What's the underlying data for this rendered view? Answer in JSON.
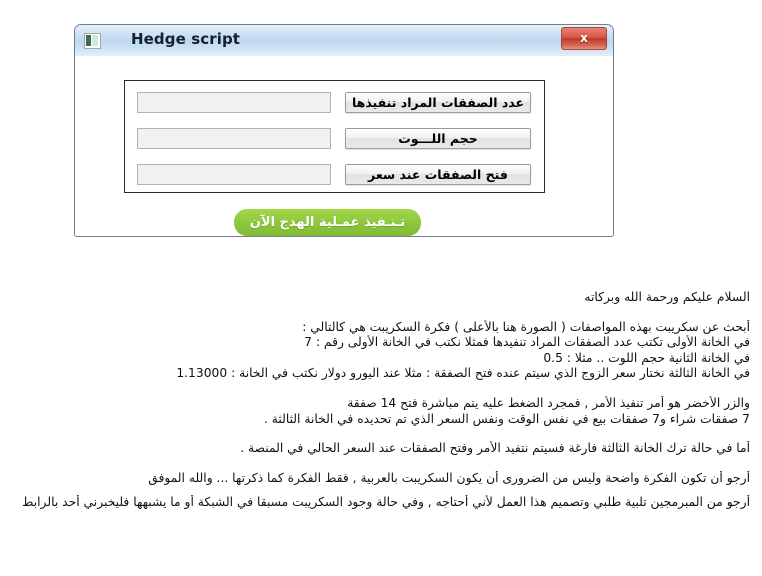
{
  "window": {
    "title": "Hedge script",
    "icon": "app-icon",
    "close_label": "x"
  },
  "form": {
    "rows": [
      {
        "input_value": "",
        "input_placeholder": "",
        "label": "عدد الصفقات المراد تنفيذها"
      },
      {
        "input_value": "",
        "input_placeholder": "",
        "label": "حجم اللـــوت"
      },
      {
        "input_value": "",
        "input_placeholder": "",
        "label": "فتح الصفقات عند سعر"
      }
    ],
    "execute_button": "تـنـفيذ عمـلية الهدج الآن"
  },
  "description": {
    "greeting": "السلام عليكم ورحمة الله وبركاته",
    "lines": [
      "أبحث عن سكريبت بهذه المواصفات ( الصورة هنا بالأعلى ) فكرة السكريبت هي كالتالي :",
      "في الخانة الأولى تكتب عدد الصفقات المراد تنفيدها  فمثلا نكتب في الخانة الأولى رقم : 7",
      "في الخانة الثانية حجم اللوت .. مثلا : 0.5",
      "في الخانة الثالثة نختار سعر الزوج الذي سيتم عنده فتح الصفقة : مثلا عند اليورو دولار نكتب في الخانة : 1.13000",
      "والزر الأخضر هو أمر تنفيذ الأمر , فمجرد الضغط عليه يتم مباشرة فتح 14 صفقة",
      "7 صفقات شراء و7 صفقات بيع في نفس الوقت ونفس السعر الذي تم تحديده في الخانة الثالثة .",
      "أما في حالة ترك الخانة الثالثة فارغة فسيتم نتفيد الأمر وفتح الصفقات عند السعر الحالي في المنصة .",
      "أرجو أن تكون الفكرة واضحة وليس من الضرورى أن يكون السكريبت بالعربية , فقط الفكرة كما ذكرتها ... والله الموفق",
      "أرجو من المبرمجين تلبية طلبي وتصميم هذا العمل لأني أحتاجه , وفي حالة وجود السكريبت مسبقا في الشبكة أو ما يشبهها فليخبرني أحد بالرابط"
    ]
  }
}
